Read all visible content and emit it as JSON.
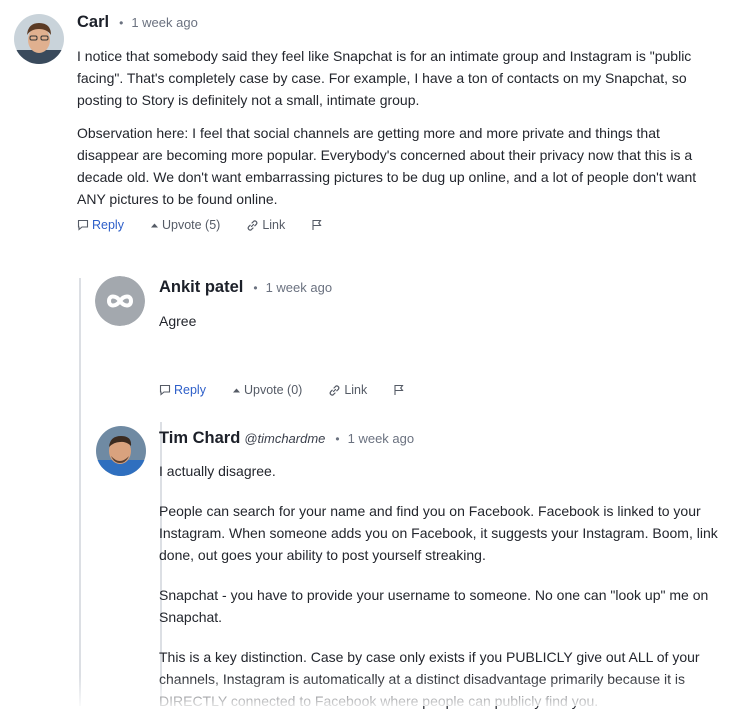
{
  "comments": [
    {
      "author": "Carl",
      "handle": "",
      "dot": "•",
      "time": "1 week ago",
      "paragraphs": [
        "I notice that somebody said they feel like Snapchat is for an intimate group and Instagram is \"public facing\". That's completely case by case. For example, I have a ton of contacts on my Snapchat, so posting to Story is definitely not a small, intimate group.",
        "Observation here: I feel that social channels are getting more and more private and things that disappear are becoming more popular. Everybody's concerned about their privacy now that this is a decade old. We don't want embarrassing pictures to be dug up online, and  a lot of people don't want ANY pictures to be found online."
      ],
      "actions": {
        "reply": "Reply",
        "upvote": "Upvote (5)",
        "link": "Link"
      }
    },
    {
      "author": "Ankit patel",
      "handle": "",
      "dot": "•",
      "time": "1 week ago",
      "paragraphs": [
        "Agree"
      ],
      "actions": {
        "reply": "Reply",
        "upvote": "Upvote (0)",
        "link": "Link"
      }
    },
    {
      "author": "Tim Chard",
      "handle": "@timchardme",
      "dot": "•",
      "time": "1 week ago",
      "paragraphs": [
        "I actually disagree.",
        "People can search for your name and find you on Facebook. Facebook is linked to your Instagram. When someone adds you on Facebook, it suggests your Instagram. Boom, link done, out goes your ability to post yourself streaking.",
        "Snapchat - you have to provide your username to someone. No one can \"look up\" me on Snapchat.",
        "This is a key distinction. Case by case only exists if you PUBLICLY give out ALL of your channels, Instagram is automatically at a distinct disadvantage primarily because it is DIRECTLY connected to Facebook where people can publicly find you."
      ]
    }
  ],
  "colors": {
    "reply_link": "#2e5fc9",
    "thread_line": "#dcdfe4",
    "default_avatar_bg": "#a3a8ae"
  }
}
